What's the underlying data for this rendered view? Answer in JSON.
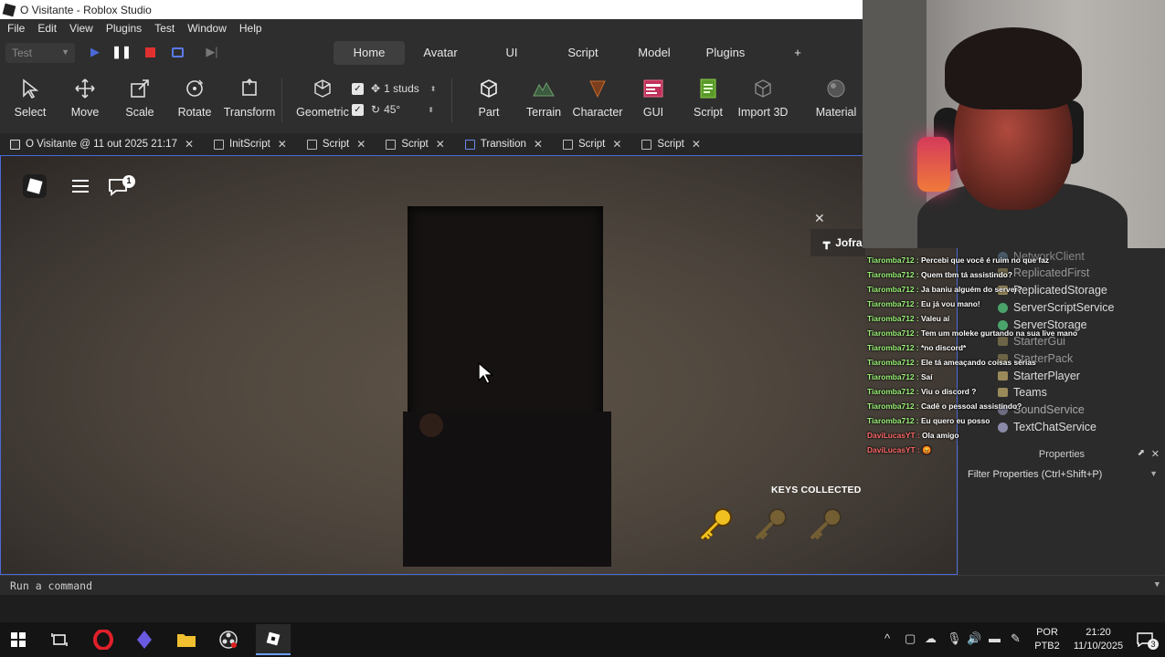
{
  "window": {
    "title": "O Visitante - Roblox Studio"
  },
  "menu": [
    "File",
    "Edit",
    "View",
    "Plugins",
    "Test",
    "Window",
    "Help"
  ],
  "topbar": {
    "test_select": "Test",
    "tabs": [
      "Home",
      "Avatar",
      "UI",
      "Script",
      "Model",
      "Plugins",
      "+"
    ],
    "active_tab": "Home"
  },
  "ribbon": {
    "tools": [
      "Select",
      "Move",
      "Scale",
      "Rotate",
      "Transform"
    ],
    "geometric": "Geometric",
    "snap_move": "1 studs",
    "snap_rotate": "45°",
    "insert": [
      "Part",
      "Terrain",
      "Character",
      "GUI",
      "Script",
      "Import 3D",
      "Material"
    ]
  },
  "doc_tabs": [
    "O Visitante @ 11 out 2025 21:17",
    "InitScript",
    "Script",
    "Script",
    "Transition",
    "Script",
    "Script"
  ],
  "viewport": {
    "keys_title": "KEYS COLLECTED",
    "chat_badge": "1",
    "join_text": "Jofra",
    "keys": {
      "collected": 1,
      "total": 3
    }
  },
  "explorer": {
    "items": [
      "NetworkClient",
      "ReplicatedFirst",
      "ReplicatedStorage",
      "ServerScriptService",
      "ServerStorage",
      "StarterGui",
      "StarterPack",
      "StarterPlayer",
      "Teams",
      "SoundService",
      "TextChatService"
    ]
  },
  "chat": [
    {
      "user": "Tiaromba712 :",
      "msg": " Percebi que você é ruim no que faz"
    },
    {
      "user": "Tiaromba712 :",
      "msg": " Quem tbm tá assistindo?"
    },
    {
      "user": "Tiaromba712 :",
      "msg": " Ja baniu alguém do server?"
    },
    {
      "user": "Tiaromba712 :",
      "msg": " Eu já vou mano!"
    },
    {
      "user": "Tiaromba712 :",
      "msg": " Valeu aí"
    },
    {
      "user": "Tiaromba712 :",
      "msg": " Tem um moleke gurtando na sua live mano"
    },
    {
      "user": "Tiaromba712 :",
      "msg": " *no discord*"
    },
    {
      "user": "Tiaromba712 :",
      "msg": " Ele tá ameaçando coisas sérias"
    },
    {
      "user": "Tiaromba712 :",
      "msg": " Saí"
    },
    {
      "user": "Tiaromba712 :",
      "msg": " Viu o discord ?"
    },
    {
      "user": "Tiaromba712 :",
      "msg": " Cadê o pessoal assistindo?"
    },
    {
      "user": "Tiaromba712 :",
      "msg": " Eu quero eu posso"
    },
    {
      "user": "DaviLucasYT :",
      "msg": " Ola amigo"
    },
    {
      "user": "DaviLucasYT :",
      "msg": " 😡"
    }
  ],
  "properties": {
    "title": "Properties",
    "filter_placeholder": "Filter Properties (Ctrl+Shift+P)"
  },
  "command": {
    "placeholder": "Run a command"
  },
  "taskbar": {
    "lang1": "POR",
    "lang2": "PTB2",
    "time": "21:20",
    "date": "11/10/2025",
    "notif_count": "3"
  },
  "colors": {
    "accent": "#4a6ad8",
    "chat_user": "#9df57a",
    "chat_user2": "#ff6a6a",
    "key_gold": "#e0b020"
  }
}
